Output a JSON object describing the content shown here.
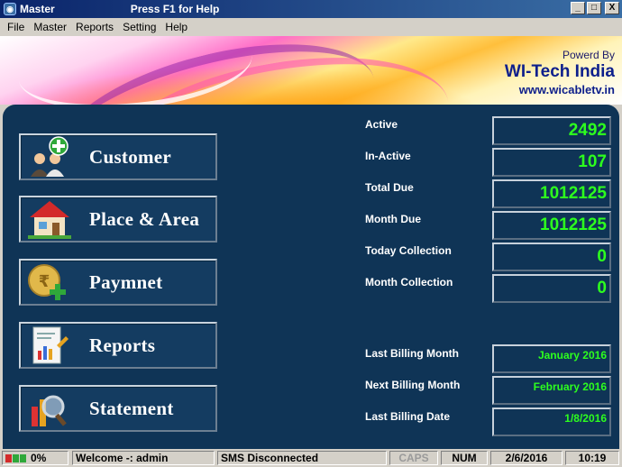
{
  "window": {
    "title": "Master",
    "help_hint": "Press F1 for Help",
    "buttons": {
      "minimize": "_",
      "maximize": "□",
      "close": "X"
    }
  },
  "menu": {
    "items": [
      "File",
      "Master",
      "Reports",
      "Setting",
      "Help"
    ]
  },
  "banner": {
    "powered_by": "Powerd By",
    "company": "WI-Tech India",
    "url": "www.wicabletv.in"
  },
  "nav": {
    "customer": "Customer",
    "place_area": "Place & Area",
    "payment": "Paymnet",
    "reports": "Reports",
    "statement": "Statement"
  },
  "stats": [
    {
      "label": "Active",
      "value": "2492"
    },
    {
      "label": "In-Active",
      "value": "107"
    },
    {
      "label": "Total Due",
      "value": "1012125"
    },
    {
      "label": "Month Due",
      "value": "1012125"
    },
    {
      "label": "Today Collection",
      "value": "0"
    },
    {
      "label": "Month Collection",
      "value": "0"
    }
  ],
  "billing": [
    {
      "label": "Last Billing Month",
      "value": "January 2016"
    },
    {
      "label": "Next Billing Month",
      "value": "February 2016"
    },
    {
      "label": "Last Billing Date",
      "value": "1/8/2016"
    }
  ],
  "statusbar": {
    "progress": "0%",
    "welcome": "Welcome -: admin",
    "sms": "SMS Disconnected",
    "caps": "CAPS",
    "num": "NUM",
    "date": "2/6/2016",
    "time": "10:19"
  },
  "colors": {
    "panel": "#0f3456",
    "value_green": "#2dff1e",
    "banner_text": "#0d1f8c"
  }
}
